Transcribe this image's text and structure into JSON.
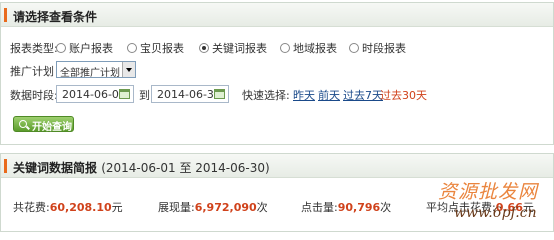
{
  "filter": {
    "title": "请选择查看条件",
    "report_type_label": "报表类型:",
    "report_types": [
      {
        "label": "账户报表",
        "selected": false
      },
      {
        "label": "宝贝报表",
        "selected": false
      },
      {
        "label": "关键词报表",
        "selected": true
      },
      {
        "label": "地域报表",
        "selected": false
      },
      {
        "label": "时段报表",
        "selected": false
      }
    ],
    "plan_label": "推广计划",
    "plan_value": "全部推广计划",
    "date_label": "数据时段:",
    "date_from": "2014-06-01",
    "date_to_sep": "到",
    "date_to": "2014-06-30",
    "quick_label": "快速选择:",
    "quick_links": [
      {
        "label": "昨天",
        "active": false
      },
      {
        "label": "前天",
        "active": false
      },
      {
        "label": "过去7天",
        "active": false
      },
      {
        "label": "过去30天",
        "active": true
      }
    ],
    "query_button": "开始查询"
  },
  "summary": {
    "title": "关键词数据简报",
    "range": "(2014-06-01 至 2014-06-30)",
    "stats": [
      {
        "key": "共花费:",
        "value": "60,208.10",
        "unit": "元"
      },
      {
        "key": "展现量:",
        "value": "6,972,090",
        "unit": "次"
      },
      {
        "key": "点击量:",
        "value": "90,796",
        "unit": "次"
      },
      {
        "key": "平均点击花费:",
        "value": "0.66",
        "unit": "元"
      }
    ]
  },
  "watermark": {
    "text": "资源批发网",
    "url": "www.6pf.cn"
  },
  "colors": {
    "accent_orange": "#e96a1c",
    "value_red": "#d0421b",
    "link_blue": "#1a4a8a",
    "button_green": "#5c9c2c"
  }
}
